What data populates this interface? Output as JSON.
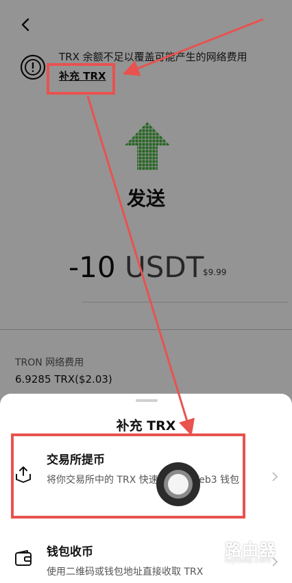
{
  "background": {
    "warning_text": "TRX 余额不足以覆盖可能产生的网络费用",
    "topup_link": "补充 TRX",
    "send_title": "发送",
    "amount_value": "-10",
    "amount_unit": "USDT",
    "fiat_value": "$9.99",
    "fee_label": "TRON 网络费用",
    "fee_value": "6.9285 TRX($2.03)"
  },
  "sheet": {
    "title": "补充 TRX",
    "options": [
      {
        "title": "交易所提币",
        "description": "将你交易所中的 TRX 快速转入到 Web3 钱包",
        "icon": "upload-tray-icon"
      },
      {
        "title": "钱包收币",
        "description": "使用二维码或钱包地址直接收取 TRX",
        "icon": "wallet-icon"
      }
    ]
  },
  "watermark": {
    "name": "路由器",
    "url": "luyouqi.com"
  },
  "colors": {
    "annotation": "#e8524f",
    "send_arrow": "#3fae3a",
    "overlay": "rgba(0,0,0,0.42)"
  }
}
